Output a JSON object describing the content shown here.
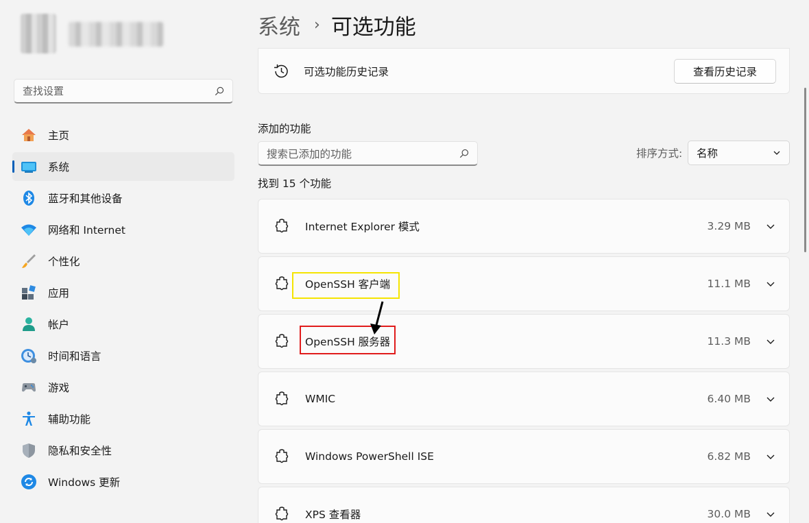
{
  "sidebar": {
    "search_placeholder": "查找设置",
    "items": [
      {
        "label": "主页",
        "icon": "home-icon",
        "active": false
      },
      {
        "label": "系统",
        "icon": "system-icon",
        "active": true
      },
      {
        "label": "蓝牙和其他设备",
        "icon": "bluetooth-icon",
        "active": false
      },
      {
        "label": "网络和 Internet",
        "icon": "wifi-icon",
        "active": false
      },
      {
        "label": "个性化",
        "icon": "brush-icon",
        "active": false
      },
      {
        "label": "应用",
        "icon": "apps-icon",
        "active": false
      },
      {
        "label": "帐户",
        "icon": "account-icon",
        "active": false
      },
      {
        "label": "时间和语言",
        "icon": "time-language-icon",
        "active": false
      },
      {
        "label": "游戏",
        "icon": "gaming-icon",
        "active": false
      },
      {
        "label": "辅助功能",
        "icon": "accessibility-icon",
        "active": false
      },
      {
        "label": "隐私和安全性",
        "icon": "shield-icon",
        "active": false
      },
      {
        "label": "Windows 更新",
        "icon": "update-icon",
        "active": false
      }
    ]
  },
  "header": {
    "breadcrumb_parent": "系统",
    "breadcrumb_separator": "›",
    "breadcrumb_current": "可选功能"
  },
  "history": {
    "label": "可选功能历史记录",
    "button": "查看历史记录"
  },
  "added": {
    "title": "添加的功能",
    "search_placeholder": "搜索已添加的功能",
    "sort_label": "排序方式:",
    "sort_value": "名称",
    "found_text": "找到 15 个功能",
    "features": [
      {
        "name": "Internet Explorer 模式",
        "size": "3.29 MB"
      },
      {
        "name": "OpenSSH 客户端",
        "size": "11.1 MB"
      },
      {
        "name": "OpenSSH 服务器",
        "size": "11.3 MB"
      },
      {
        "name": "WMIC",
        "size": "6.40 MB"
      },
      {
        "name": "Windows PowerShell ISE",
        "size": "6.82 MB"
      },
      {
        "name": "XPS 查看器",
        "size": "30.0 MB"
      }
    ]
  },
  "colors": {
    "accent": "#005fb8",
    "highlight_yellow": "#f5e400",
    "highlight_red": "#e01b1b"
  }
}
